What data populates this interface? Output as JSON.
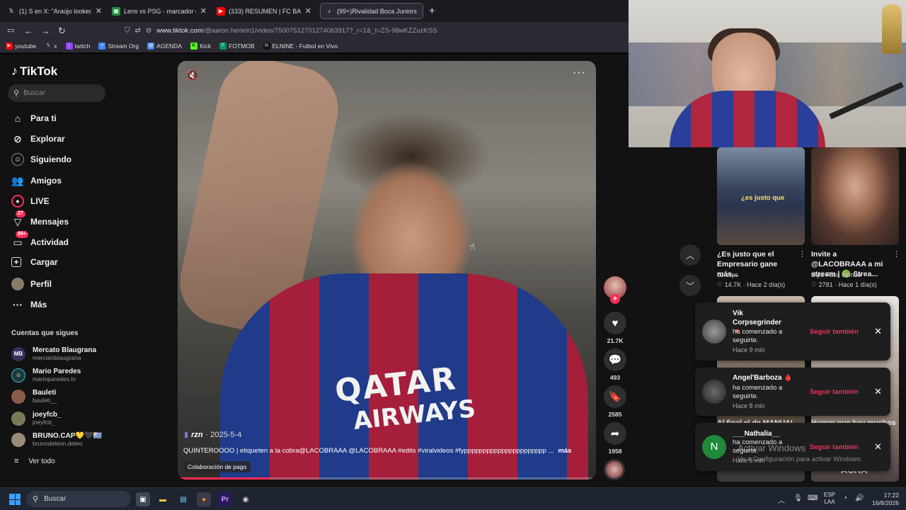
{
  "browser": {
    "tabs": [
      {
        "icon": "x-icon",
        "title": "(1) S en X: \"Araújo looked solid"
      },
      {
        "icon": "sheets-icon",
        "title": "Lens vs PSG - marcador en vivo"
      },
      {
        "icon": "youtube-icon",
        "title": "(333) RESUMEN | FC BASEL 2 vs"
      },
      {
        "icon": "tiktok-icon",
        "title": "(99+)Rivalidad Boca Juniors vs"
      }
    ],
    "url_domain": "www.tiktok.com",
    "url_path": "/@aaron.herlein1/video/7500751270127406391​7?_r=1&_t=ZS-98wKZZuzKSS",
    "bookmarks": [
      "youtube",
      "x",
      "twitch",
      "Stream Org",
      "AGENDA",
      "Kick",
      "FOTMOB",
      "ELNINE - Futbol en Vivo"
    ]
  },
  "sidebar": {
    "logo": "TikTok",
    "search_placeholder": "Buscar",
    "nav": [
      {
        "label": "Para ti",
        "icon": "home-icon"
      },
      {
        "label": "Explorar",
        "icon": "compass-icon"
      },
      {
        "label": "Siguiendo",
        "icon": "following-icon"
      },
      {
        "label": "Amigos",
        "icon": "friends-icon"
      },
      {
        "label": "LIVE",
        "icon": "live-icon"
      },
      {
        "label": "Mensajes",
        "icon": "message-icon",
        "badge": "27"
      },
      {
        "label": "Actividad",
        "icon": "activity-icon",
        "badge": "99+"
      },
      {
        "label": "Cargar",
        "icon": "upload-icon"
      },
      {
        "label": "Perfil",
        "icon": "profile-icon"
      },
      {
        "label": "Más",
        "icon": "more-icon"
      }
    ],
    "following_header": "Cuentas que sigues",
    "accounts": [
      {
        "name": "Mercato Blaugrana",
        "handle": "mercatoblaugrana",
        "initials": "MB"
      },
      {
        "name": "Mario Paredes",
        "handle": "marioparedes.tv",
        "initials": ""
      },
      {
        "name": "Bauleti",
        "handle": "bauleti__",
        "initials": ""
      },
      {
        "name": "joeyfcb_",
        "handle": "joeyfcb_",
        "initials": ""
      },
      {
        "name": "BRUNO.CAP💛🖤🇺🇾",
        "handle": "brunodeleon.deleo",
        "initials": ""
      }
    ],
    "see_all": "Ver todo"
  },
  "video": {
    "author": "rzn",
    "date": "2025-5-4",
    "caption": "QUINTEROOOO | etiqueten a la cobra@LACOBRAAA @LACOBRAAA #edits #viralvideos #fypppppppppppppppppppppp ...",
    "more_label": "más",
    "collab": "Colaboración de pago",
    "sponsor_line1": "QATAR",
    "sponsor_line2": "AIRWAYS",
    "progress": 0.22
  },
  "actions": {
    "likes": "21.7K",
    "comments": "493",
    "saves": "2585",
    "shares": "1958"
  },
  "related": [
    {
      "title": "¿Es justo que el Empresario gane más...",
      "author": "c2.clips",
      "likes": "14.7K",
      "time": "Hace 2 día(s)",
      "overlay": "¿es justo que"
    },
    {
      "title": "Invite a @LACOBRAAA a mi stream | 🟢 Strea...",
      "author": "clips Facu Iriondo",
      "likes": "2781",
      "time": "Hace 1 día(s)",
      "overlay": ""
    }
  ],
  "related_bottom": [
    {
      "title": "Al final el de MANUAL",
      "overlay": ""
    },
    {
      "title": "Humor que hay muchos",
      "overlay": "AURA"
    }
  ],
  "notifications": [
    {
      "name": "Vik Corpsegrinder 🔻",
      "message": "ha comenzado a seguirte.",
      "time": "Hace 9 min",
      "avatar_letter": ""
    },
    {
      "name": "Angel'Barboza 🩸",
      "message": "ha comenzado a seguirte.",
      "time": "Hace 8 min",
      "avatar_letter": ""
    },
    {
      "name": "___Nathalia__",
      "message": "ha comenzado a seguirte.",
      "time": "Hace 5 min",
      "avatar_letter": "N"
    }
  ],
  "follow_back_label": "Seguir también",
  "windows_watermark": {
    "line1": "Activar Windows",
    "line2": "Ve a Configuración para activar Windows."
  },
  "taskbar": {
    "search_placeholder": "Buscar",
    "lang_line1": "ESP",
    "lang_line2": "LAA",
    "time": "17:22",
    "date": "16/8/2026"
  },
  "colors": {
    "accent": "#fe2c55",
    "windows_blue": "#3ba1ff"
  }
}
